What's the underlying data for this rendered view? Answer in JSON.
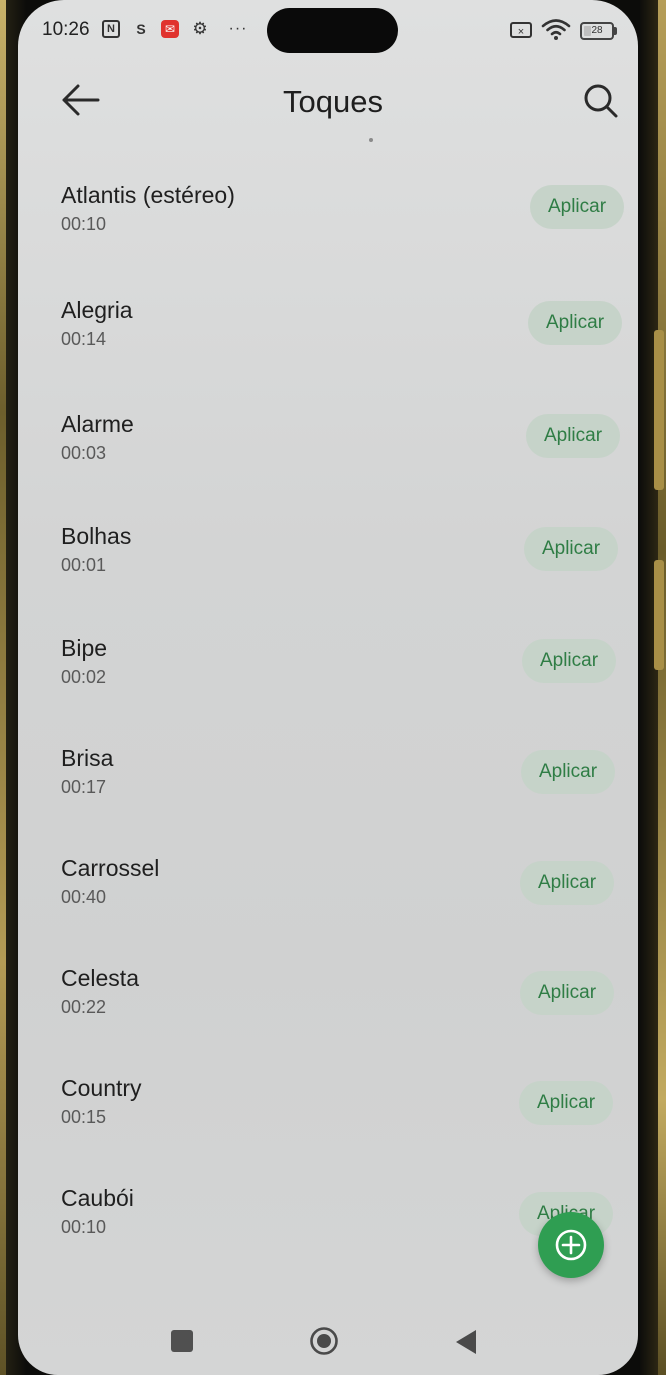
{
  "status_bar": {
    "time": "10:26",
    "nfc_glyph": "N",
    "s_glyph": "S",
    "more_glyph": "···",
    "sim_glyph": "×",
    "battery_level": "28"
  },
  "header": {
    "title": "Toques"
  },
  "ringtones": [
    {
      "name": "Atlantis (estéreo)",
      "duration": "00:10",
      "action": "Aplicar"
    },
    {
      "name": "Alegria",
      "duration": "00:14",
      "action": "Aplicar"
    },
    {
      "name": "Alarme",
      "duration": "00:03",
      "action": "Aplicar"
    },
    {
      "name": "Bolhas",
      "duration": "00:01",
      "action": "Aplicar"
    },
    {
      "name": "Bipe",
      "duration": "00:02",
      "action": "Aplicar"
    },
    {
      "name": "Brisa",
      "duration": "00:17",
      "action": "Aplicar"
    },
    {
      "name": "Carrossel",
      "duration": "00:40",
      "action": "Aplicar"
    },
    {
      "name": "Celesta",
      "duration": "00:22",
      "action": "Aplicar"
    },
    {
      "name": "Country",
      "duration": "00:15",
      "action": "Aplicar"
    },
    {
      "name": "Caubói",
      "duration": "00:10",
      "action": "Aplicar"
    }
  ],
  "icons": {
    "back": "arrow-left-icon",
    "search": "search-icon",
    "add": "plus-circle-icon",
    "nav_recent": "square-icon",
    "nav_home": "circle-icon",
    "nav_back": "triangle-back-icon"
  },
  "colors": {
    "accent": "#2f9e52",
    "button_bg": "#c6d3c9",
    "button_text": "#2f7d45"
  }
}
